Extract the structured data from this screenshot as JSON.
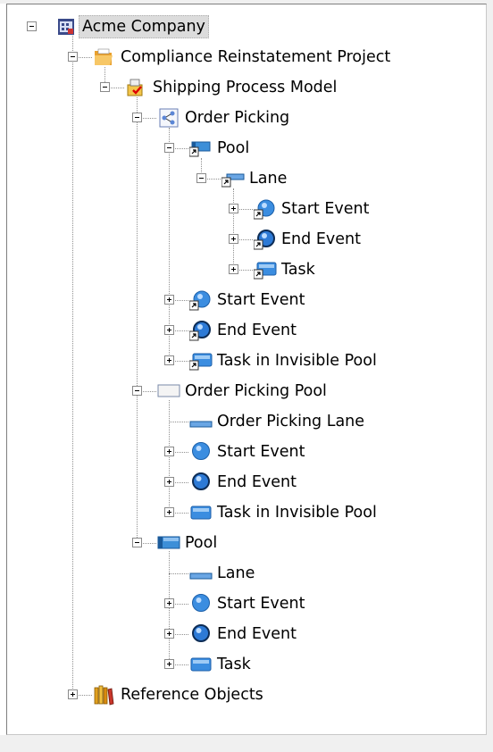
{
  "tree": {
    "root": {
      "label": "Acme Company",
      "icon": "company-icon"
    },
    "project": {
      "label": "Compliance Reinstatement Project",
      "icon": "open-folder-icon"
    },
    "model": {
      "label": "Shipping Process Model",
      "icon": "process-model-icon"
    },
    "diagram": {
      "label": "Order Picking",
      "icon": "diagram-icon"
    },
    "pool1": {
      "label": "Pool",
      "icon": "pool-shortcut-icon"
    },
    "lane1": {
      "label": "Lane",
      "icon": "lane-shortcut-icon"
    },
    "lane1_start": {
      "label": "Start Event",
      "icon": "start-event-shortcut-icon"
    },
    "lane1_end": {
      "label": "End Event",
      "icon": "end-event-shortcut-icon"
    },
    "lane1_task": {
      "label": "Task",
      "icon": "task-shortcut-icon"
    },
    "diag_start": {
      "label": "Start Event",
      "icon": "start-event-shortcut-icon"
    },
    "diag_end": {
      "label": "End Event",
      "icon": "end-event-shortcut-icon"
    },
    "diag_task": {
      "label": "Task in Invisible Pool",
      "icon": "task-shortcut-icon"
    },
    "op_pool": {
      "label": "Order Picking Pool",
      "icon": "invisible-pool-icon"
    },
    "op_lane": {
      "label": "Order Picking Lane",
      "icon": "lane-icon"
    },
    "op_start": {
      "label": "Start Event",
      "icon": "start-event-icon"
    },
    "op_end": {
      "label": "End Event",
      "icon": "end-event-icon"
    },
    "op_task": {
      "label": "Task in Invisible Pool",
      "icon": "task-icon"
    },
    "pool2": {
      "label": "Pool",
      "icon": "pool-icon"
    },
    "pool2_lane": {
      "label": "Lane",
      "icon": "lane-icon"
    },
    "pool2_start": {
      "label": "Start Event",
      "icon": "start-event-icon"
    },
    "pool2_end": {
      "label": "End Event",
      "icon": "end-event-icon"
    },
    "pool2_task": {
      "label": "Task",
      "icon": "task-icon"
    },
    "refs": {
      "label": "Reference Objects",
      "icon": "library-books-icon"
    }
  }
}
